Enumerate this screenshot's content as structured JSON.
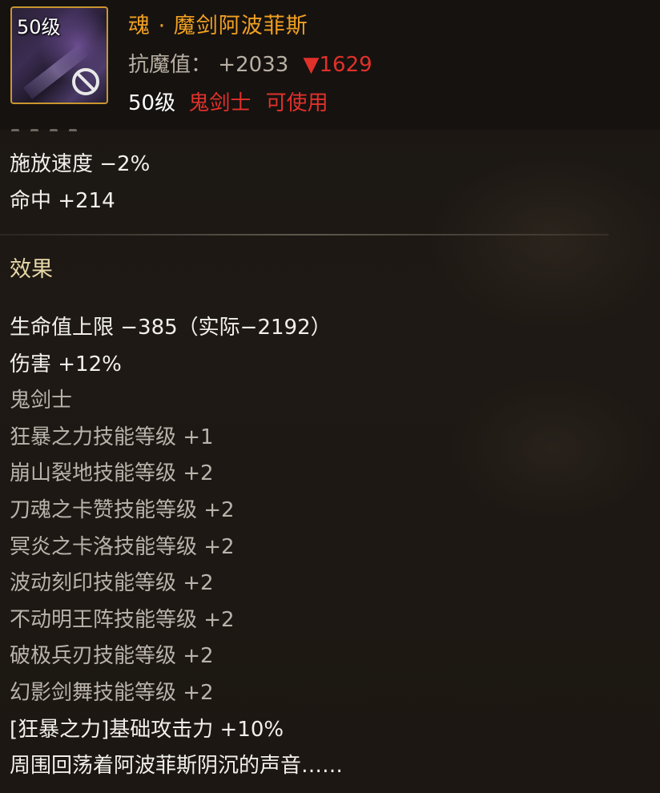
{
  "item": {
    "icon_level": "50级",
    "name": "魂 · 魔剑阿波菲斯",
    "stat_label": "抗魔值：",
    "stat_value": "+2033",
    "stat_down_symbol": "▼",
    "stat_down_value": "1629",
    "req_level": "50级",
    "req_class": "鬼剑士",
    "req_usable": "可使用",
    "icon_semantic": "prohibited-icon"
  },
  "stats_top": [
    "施放速度 −2%",
    "命中 +214"
  ],
  "effect_title": "效果",
  "effects": [
    {
      "text": "生命值上限 −385（实际−2192）",
      "style": "white"
    },
    {
      "text": "伤害 +12%",
      "style": "white"
    },
    {
      "text": "鬼剑士",
      "style": "gray"
    },
    {
      "text": "狂暴之力技能等级 +1",
      "style": "gray"
    },
    {
      "text": "崩山裂地技能等级 +2",
      "style": "gray"
    },
    {
      "text": "刀魂之卡赞技能等级 +2",
      "style": "gray"
    },
    {
      "text": "冥炎之卡洛技能等级 +2",
      "style": "gray"
    },
    {
      "text": "波动刻印技能等级 +2",
      "style": "gray"
    },
    {
      "text": "不动明王阵技能等级 +2",
      "style": "gray"
    },
    {
      "text": "破极兵刃技能等级 +2",
      "style": "gray"
    },
    {
      "text": "幻影剑舞技能等级 +2",
      "style": "gray"
    },
    {
      "text": "[狂暴之力]基础攻击力 +10%",
      "style": "white"
    },
    {
      "text": "周围回荡着阿波菲斯阴沉的声音……",
      "style": "white"
    }
  ],
  "colors": {
    "name_gold": "#f0a021",
    "red": "#e0312a",
    "white": "#f2f0ec",
    "gray": "#b9b3ab",
    "icon_border": "#c9962e"
  }
}
